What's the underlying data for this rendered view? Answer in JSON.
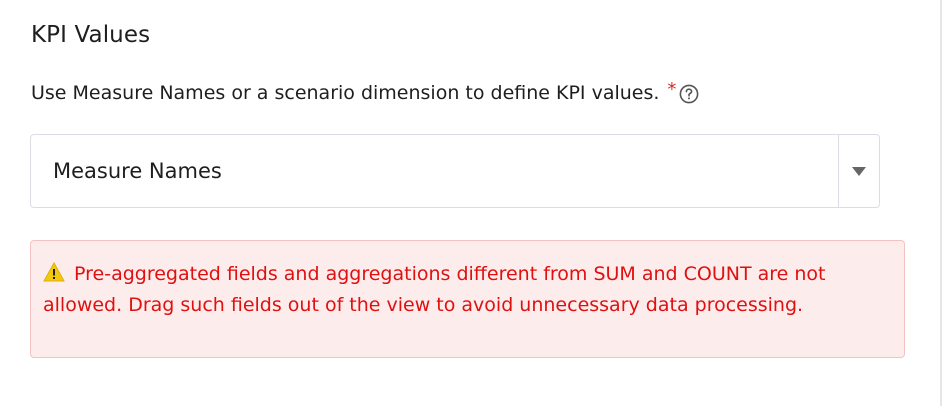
{
  "section": {
    "title": "KPI Values"
  },
  "kpi_field": {
    "label": "Use Measure Names or a scenario dimension to define KPI values.",
    "required_mark": "*",
    "help_icon": "question-circle-icon",
    "selected_value": "Measure Names",
    "dropdown_icon": "caret-down-icon"
  },
  "warning": {
    "icon": "warning-triangle-icon",
    "message": "Pre-aggregated fields and aggregations different from SUM and COUNT are not allowed. Drag such fields out of the view to avoid unnecessary data processing."
  },
  "colors": {
    "warning_text": "#e01010",
    "warning_background": "#fdecec",
    "warning_border": "#f5c2c2",
    "required": "#d22b2b"
  }
}
